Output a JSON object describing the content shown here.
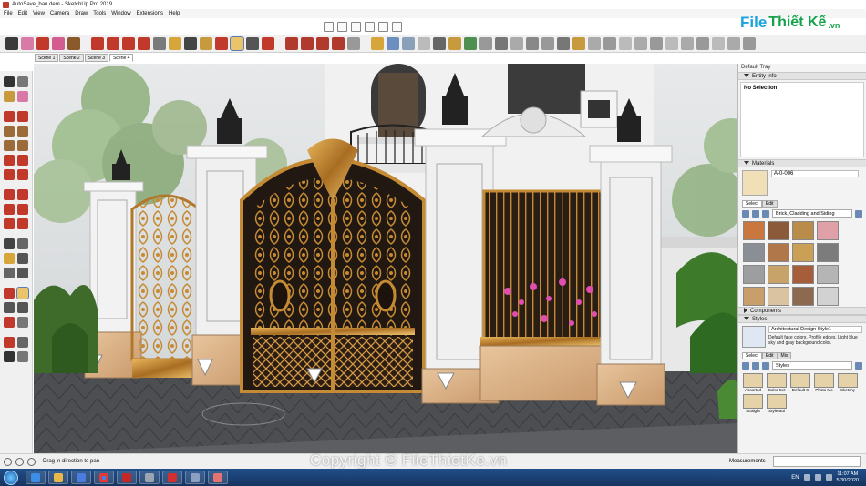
{
  "window": {
    "title": "AutoSave_ban dem - SketchUp Pro 2019"
  },
  "menu": [
    "File",
    "Edit",
    "View",
    "Camera",
    "Draw",
    "Tools",
    "Window",
    "Extensions",
    "Help"
  ],
  "logo": {
    "file": "File",
    "rest": "Thiết Kế",
    "suffix": ".vn"
  },
  "scene_tabs": [
    "Scene 1",
    "Scene 2",
    "Scene 3",
    "Scene 4"
  ],
  "active_scene": "Scene 4",
  "tray": {
    "title": "Default Tray",
    "entity_info": {
      "label": "Entity Info",
      "selection": "No Selection"
    },
    "materials": {
      "label": "Materials",
      "current_name": "A-0-006",
      "tab_select": "Select",
      "tab_edit": "Edit",
      "library": "Brick, Cladding and Siding",
      "swatch_colors": [
        "#c9763f",
        "#8a5a3b",
        "#b98c4a",
        "#e0a0a8",
        "#8a8f95",
        "#b0774a",
        "#caa057",
        "#7c7c7c",
        "#9c9e9f",
        "#c7a36a",
        "#a65d3a",
        "#b5b5b5",
        "#c89f6b",
        "#d9c3a0",
        "#8d6a4f",
        "#d2d2d2"
      ]
    },
    "components": {
      "label": "Components"
    },
    "styles": {
      "label": "Styles",
      "current_name": "Architectural Design Style1",
      "description": "Default face colors. Profile edges. Light blue sky and gray background color.",
      "tab_select": "Select",
      "tab_edit": "Edit",
      "tab_mix": "Mix",
      "library": "Styles",
      "items": [
        "Assorted",
        "Color Set",
        "Default S",
        "Photo Mo",
        "Sketchy",
        "Straight",
        "Style Bui"
      ]
    }
  },
  "status": {
    "text": "Drag in direction to pan",
    "measurements_label": "Measurements"
  },
  "taskbar": {
    "language": "EN",
    "time": "11:07 AM",
    "date": "5/30/2020"
  },
  "watermark": "Copyright © FileThietKe.vn"
}
